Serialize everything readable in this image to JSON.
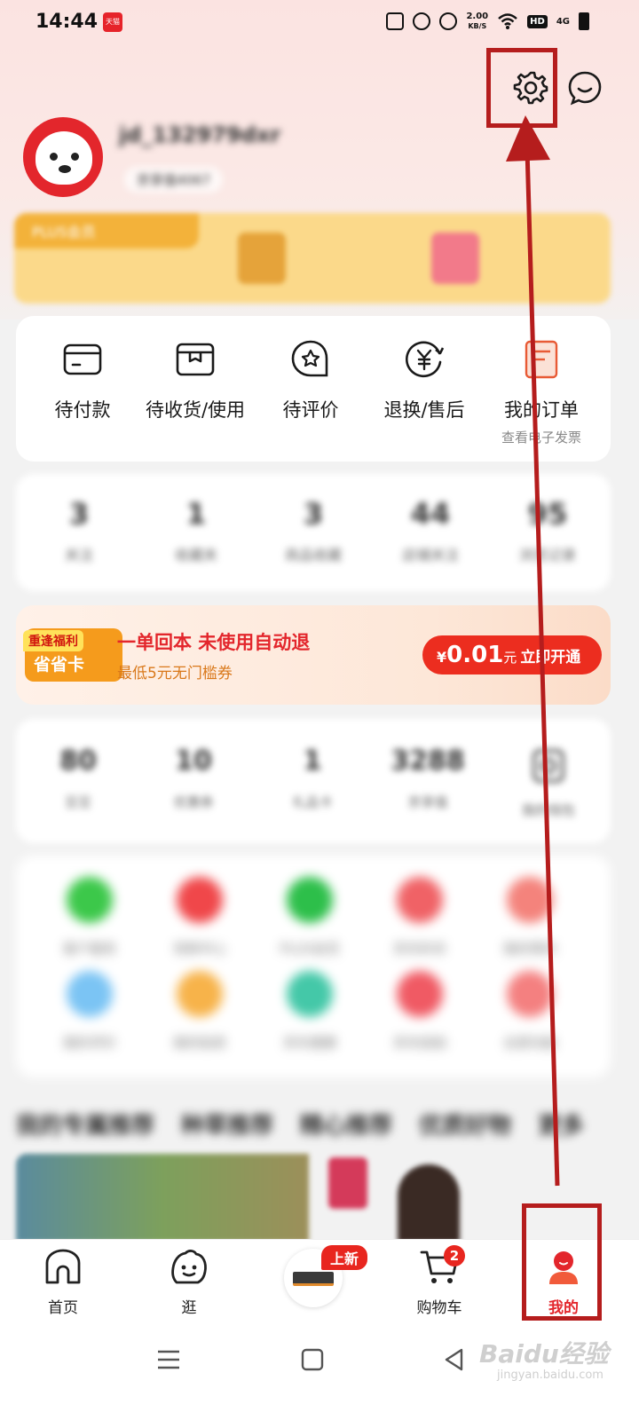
{
  "status_bar": {
    "time": "14:44",
    "network_speed": "2.00",
    "network_unit": "KB/S",
    "hd_label": "HD",
    "net_type": "4G",
    "mini_badge": "天猫"
  },
  "profile": {
    "username": "jd_132979dxr",
    "sub_label": "京享值4067"
  },
  "vip_banner": {
    "tag": "PLUS会员"
  },
  "orders": [
    {
      "label": "待付款",
      "icon": "wallet-icon"
    },
    {
      "label": "待收货/使用",
      "icon": "package-icon"
    },
    {
      "label": "待评价",
      "icon": "review-icon"
    },
    {
      "label": "退换/售后",
      "icon": "refund-icon"
    },
    {
      "label": "我的订单",
      "sub": "查看电子发票",
      "icon": "orders-icon"
    }
  ],
  "stats": [
    {
      "value": "3",
      "label": "关注"
    },
    {
      "value": "1",
      "label": "收藏夹"
    },
    {
      "value": "3",
      "label": "商品收藏"
    },
    {
      "value": "44",
      "label": "店铺关注"
    },
    {
      "value": "95",
      "label": "浏览记录"
    }
  ],
  "promo": {
    "badge_top": "重逢福利",
    "badge_main": "省省卡",
    "title": "一单回本  未使用自动退",
    "subtitle": "最低5元无门槛券",
    "currency": "¥",
    "price": "0.01",
    "unit": "元",
    "action": "立即开通"
  },
  "assets": [
    {
      "value": "80",
      "label": "豆豆"
    },
    {
      "value": "10",
      "label": "优惠券"
    },
    {
      "value": "1",
      "label": "礼品卡"
    },
    {
      "value": "3288",
      "label": "京享值"
    },
    {
      "value": "",
      "label": "我的钱包"
    }
  ],
  "tools": [
    {
      "label": "客户服务",
      "color": "#3cc84a"
    },
    {
      "label": "领券中心",
      "color": "#f0474a"
    },
    {
      "label": "PLUS会员",
      "color": "#2dbf4a"
    },
    {
      "label": "京东秒杀",
      "color": "#f06266"
    },
    {
      "label": "我的预约",
      "color": "#f4837c"
    },
    {
      "label": "我的评价",
      "color": "#7bc4f4"
    },
    {
      "label": "我的拍卖",
      "color": "#f7b34a"
    },
    {
      "label": "京东健康",
      "color": "#44c8a8"
    },
    {
      "label": "京东拍拍",
      "color": "#f05a64"
    },
    {
      "label": "全部功能",
      "color": "#f48080"
    }
  ],
  "recommend_tabs": [
    "我的专属推荐",
    "种草推荐",
    "精心推荐",
    "优质好物",
    "更多"
  ],
  "bottom_nav": [
    {
      "label": "首页",
      "icon": "home-icon"
    },
    {
      "label": "逛",
      "icon": "explore-icon"
    },
    {
      "label": "",
      "icon": "featured-product-icon"
    },
    {
      "label": "购物车",
      "icon": "cart-icon"
    },
    {
      "label": "我的",
      "icon": "profile-icon"
    }
  ],
  "new_badge": "上新",
  "cart_count": "2",
  "watermark": {
    "brand": "Baidu经验",
    "url": "jingyan.baidu.com"
  },
  "colors": {
    "brand_red": "#e3262c",
    "annotation_red": "#b51d1d"
  }
}
